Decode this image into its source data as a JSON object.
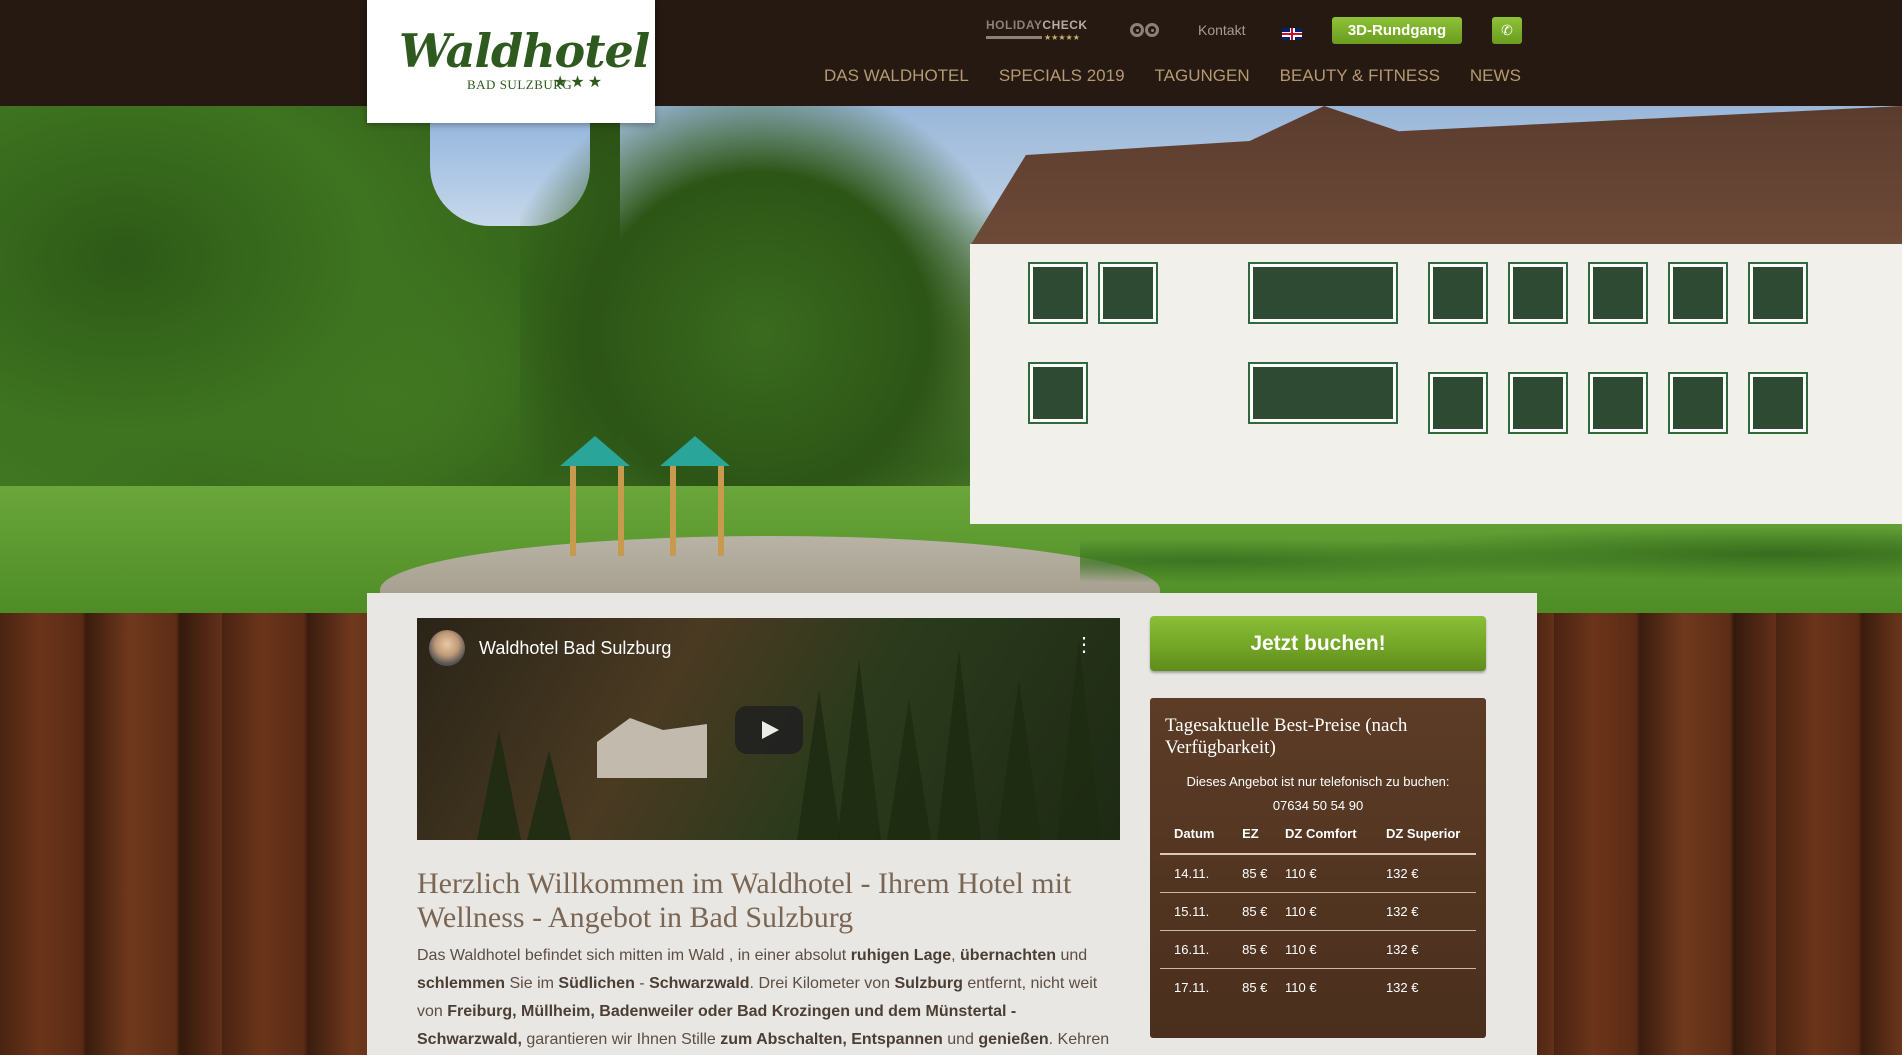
{
  "brand": {
    "name": "Waldhotel",
    "subline": "BAD SULZBURG",
    "stars": "★★★"
  },
  "utility": {
    "holidaycheck": {
      "part1": "HOLIDAY",
      "part2": "CHECK",
      "stars": "★★★★★"
    },
    "tripadvisor_icon": "owl-eyes-icon",
    "kontakt": "Kontakt",
    "language_flag": "uk-flag-icon",
    "tour_button": "3D-Rundgang",
    "phone_icon": "phone-icon"
  },
  "nav": [
    "DAS WALDHOTEL",
    "SPECIALS 2019",
    "TAGUNGEN",
    "BEAUTY & FITNESS",
    "NEWS"
  ],
  "video": {
    "title": "Waldhotel Bad Sulzburg",
    "menu_icon": "⋮",
    "play_icon": "play-icon"
  },
  "main": {
    "headline": "Herzlich Willkommen im Waldhotel - Ihrem Hotel mit Wellness - Angebot in Bad Sulzburg",
    "intro": [
      {
        "t": "Das Waldhotel befindet sich mitten im Wald , in einer absolut "
      },
      {
        "t": "ruhigen Lage",
        "b": true
      },
      {
        "t": ", "
      },
      {
        "t": "übernachten",
        "b": true
      },
      {
        "t": " und "
      },
      {
        "t": "schlemmen",
        "b": true
      },
      {
        "t": " Sie im "
      },
      {
        "t": "Südlichen",
        "b": true
      },
      {
        "t": " - "
      },
      {
        "t": "Schwarzwald",
        "b": true
      },
      {
        "t": ". Drei Kilometer von "
      },
      {
        "t": "Sulzburg",
        "b": true
      },
      {
        "t": " entfernt, nicht weit von "
      },
      {
        "t": "Freiburg, Müllheim, Badenweiler oder Bad Krozingen und dem Münstertal - Schwarzwald,",
        "b": true
      },
      {
        "t": " garantieren wir Ihnen Stille  "
      },
      {
        "t": "zum Abschalten, Entspannen",
        "b": true
      },
      {
        "t": " und "
      },
      {
        "t": "genießen",
        "b": true
      },
      {
        "t": ". Kehren"
      }
    ]
  },
  "sidebar": {
    "book_button": "Jetzt buchen!",
    "prices": {
      "title": "Tagesaktuelle Best-Preise (nach Verfügbarkeit)",
      "note": "Dieses Angebot ist nur telefonisch zu buchen:",
      "phone": "07634 50 54 90",
      "columns": [
        "Datum",
        "EZ",
        "DZ Comfort",
        "DZ Superior"
      ],
      "rows": [
        [
          "14.11.",
          "85 €",
          "110 €",
          "132 €"
        ],
        [
          "15.11.",
          "85 €",
          "110 €",
          "132 €"
        ],
        [
          "16.11.",
          "85 €",
          "110 €",
          "132 €"
        ],
        [
          "17.11.",
          "85 €",
          "110 €",
          "132 €"
        ]
      ]
    }
  }
}
